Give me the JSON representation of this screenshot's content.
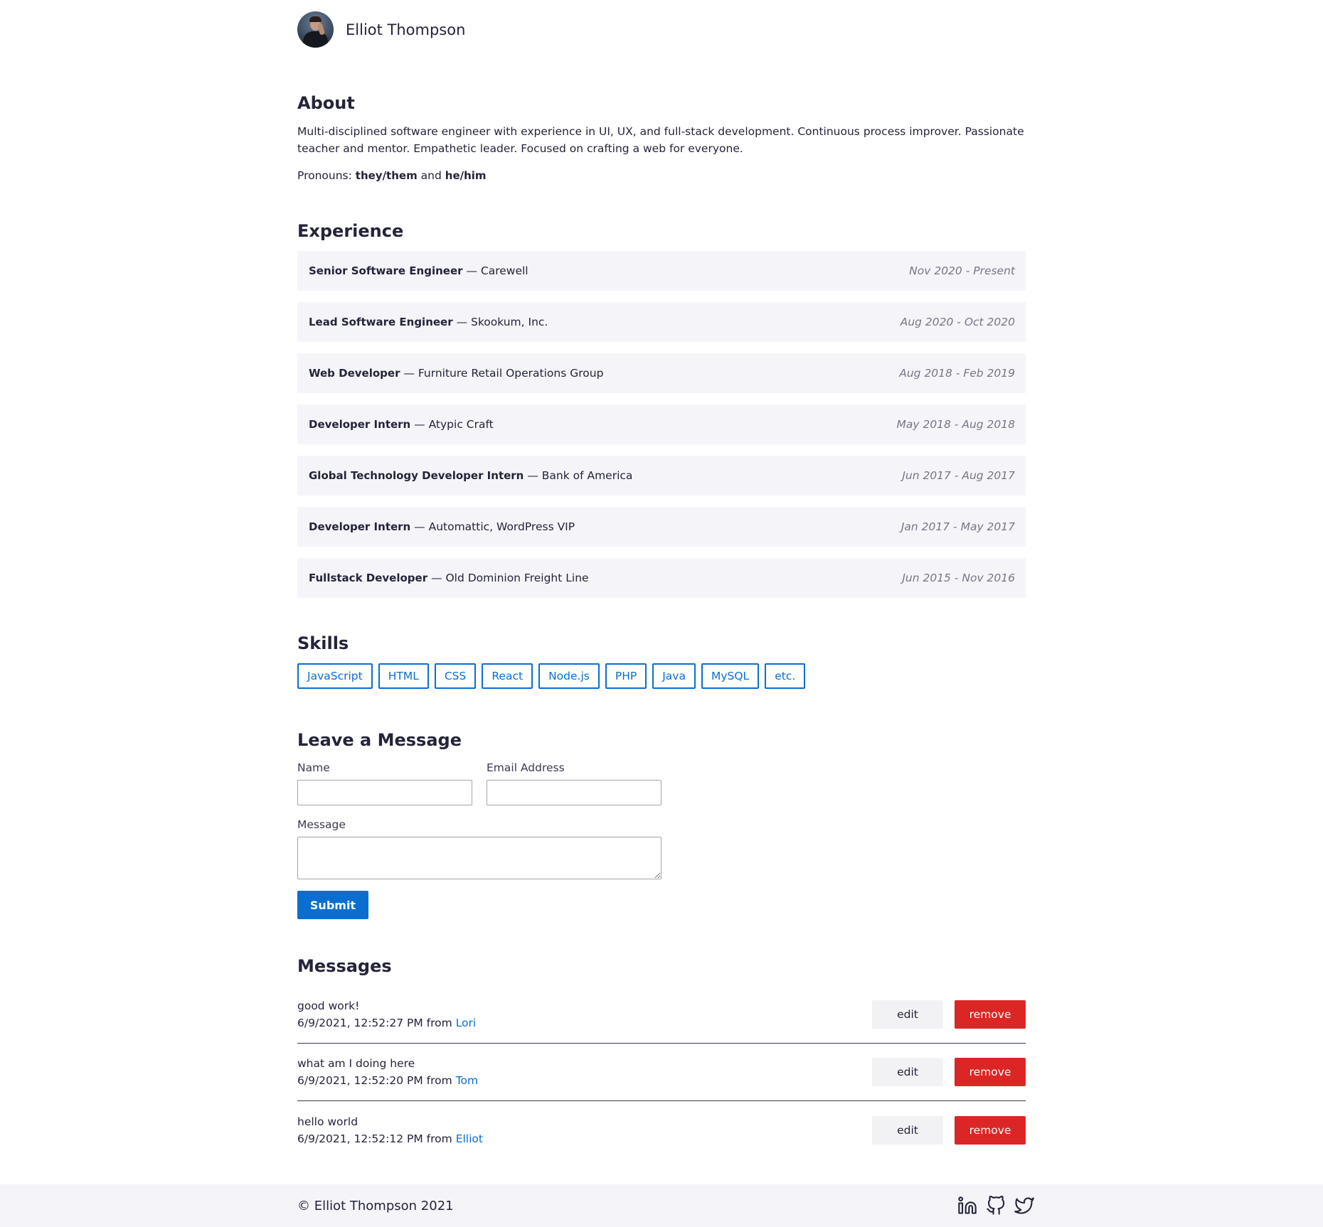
{
  "header": {
    "name": "Elliot Thompson"
  },
  "about": {
    "heading": "About",
    "text": "Multi-disciplined software engineer with experience in UI, UX, and full-stack development. Continuous process improver. Passionate teacher and mentor. Empathetic leader. Focused on crafting a web for everyone.",
    "pronouns_label": "Pronouns:",
    "pronoun_1": "they/them",
    "pronoun_joiner": "and",
    "pronoun_2": "he/him"
  },
  "experience": {
    "heading": "Experience",
    "items": [
      {
        "role": "Senior Software Engineer",
        "company": "— Carewell",
        "dates": "Nov 2020 - Present"
      },
      {
        "role": "Lead Software Engineer",
        "company": "— Skookum, Inc.",
        "dates": "Aug 2020 - Oct 2020"
      },
      {
        "role": "Web Developer",
        "company": "— Furniture Retail Operations Group",
        "dates": "Aug 2018 - Feb 2019"
      },
      {
        "role": "Developer Intern",
        "company": "— Atypic Craft",
        "dates": "May 2018 - Aug 2018"
      },
      {
        "role": "Global Technology Developer Intern",
        "company": "— Bank of America",
        "dates": "Jun 2017 - Aug 2017"
      },
      {
        "role": "Developer Intern",
        "company": "— Automattic, WordPress VIP",
        "dates": "Jan 2017 - May 2017"
      },
      {
        "role": "Fullstack Developer",
        "company": "— Old Dominion Freight Line",
        "dates": "Jun 2015 - Nov 2016"
      }
    ]
  },
  "skills": {
    "heading": "Skills",
    "items": [
      "JavaScript",
      "HTML",
      "CSS",
      "React",
      "Node.js",
      "PHP",
      "Java",
      "MySQL",
      "etc."
    ]
  },
  "form": {
    "heading": "Leave a Message",
    "name_label": "Name",
    "name_value": "",
    "email_label": "Email Address",
    "email_value": "",
    "message_label": "Message",
    "message_value": "",
    "submit_label": "Submit"
  },
  "messages": {
    "heading": "Messages",
    "from_label": "from",
    "edit_label": "edit",
    "remove_label": "remove",
    "items": [
      {
        "text": "good work!",
        "timestamp": "6/9/2021, 12:52:27 PM",
        "author": "Lori"
      },
      {
        "text": "what am I doing here",
        "timestamp": "6/9/2021, 12:52:20 PM",
        "author": "Tom"
      },
      {
        "text": "hello world",
        "timestamp": "6/9/2021, 12:52:12 PM",
        "author": "Elliot"
      }
    ]
  },
  "footer": {
    "copyright": "© Elliot Thompson 2021",
    "icons": [
      "linkedin-icon",
      "github-icon",
      "twitter-icon"
    ]
  },
  "colors": {
    "accent": "#0a6ed1",
    "danger": "#dc2626",
    "panel": "#f5f5f9",
    "text": "#24243a"
  }
}
